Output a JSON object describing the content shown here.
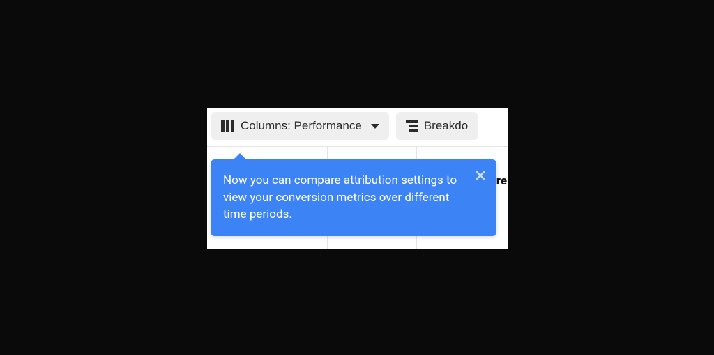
{
  "toolbar": {
    "columns": {
      "label": "Columns: Performance"
    },
    "breakdown": {
      "label": "Breakdo"
    }
  },
  "tooltip": {
    "message": "Now you can compare attribution settings to view your conversion metrics over different time periods."
  },
  "peek_text": "re",
  "colors": {
    "tooltip_bg": "#3c83f6",
    "button_bg": "#efefef"
  }
}
